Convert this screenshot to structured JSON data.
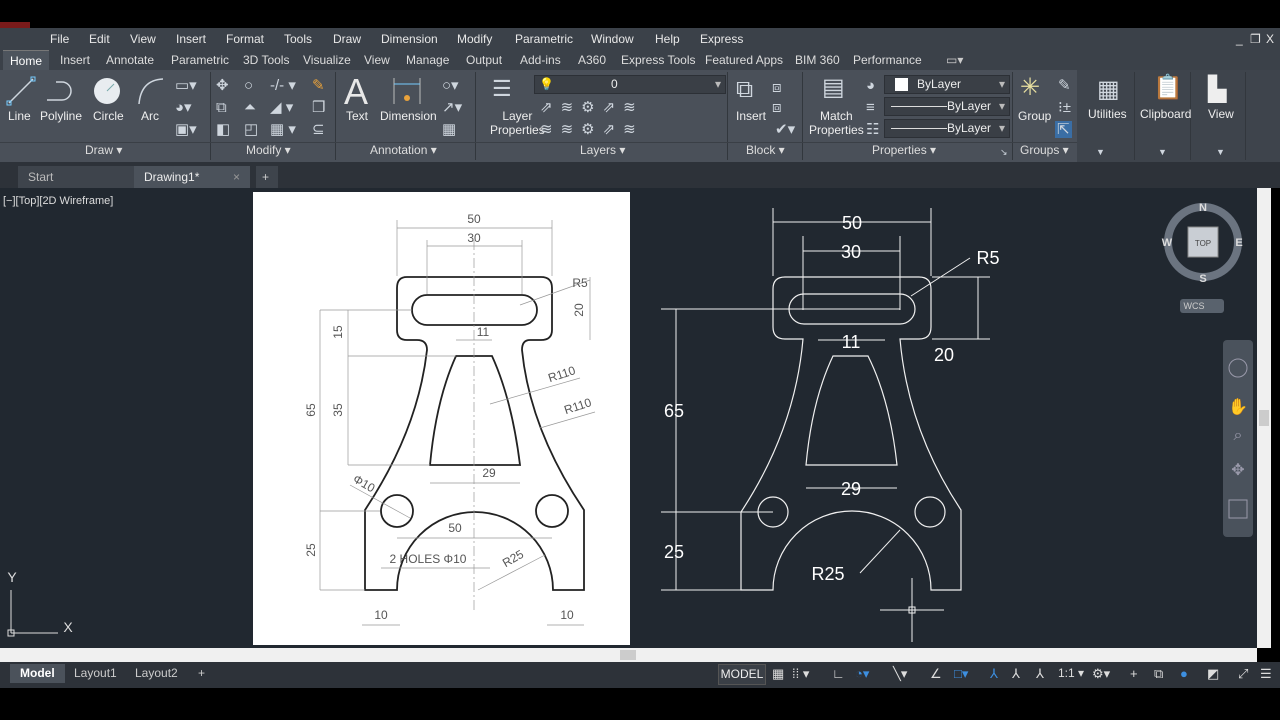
{
  "menu": [
    "File",
    "Edit",
    "View",
    "Insert",
    "Format",
    "Tools",
    "Draw",
    "Dimension",
    "Modify",
    "Parametric",
    "Window",
    "Help",
    "Express"
  ],
  "window_controls": {
    "minimize": "_",
    "restore": "❐",
    "close": "X"
  },
  "ribbon_tabs": [
    "Home",
    "Insert",
    "Annotate",
    "Parametric",
    "3D Tools",
    "Visualize",
    "View",
    "Manage",
    "Output",
    "Add-ins",
    "A360",
    "Express Tools",
    "Featured Apps",
    "BIM 360",
    "Performance"
  ],
  "ribbon": {
    "draw": {
      "title": "Draw ▾",
      "line": "Line",
      "polyline": "Polyline",
      "circle": "Circle",
      "arc": "Arc"
    },
    "modify": {
      "title": "Modify ▾"
    },
    "annotation": {
      "title": "Annotation ▾",
      "text": "Text",
      "dimension": "Dimension"
    },
    "layers": {
      "title": "Layers ▾",
      "layer_properties_1": "Layer",
      "layer_properties_2": "Properties",
      "current_layer": "0"
    },
    "block": {
      "title": "Block ▾",
      "insert": "Insert"
    },
    "properties": {
      "title": "Properties ▾",
      "match_1": "Match",
      "match_2": "Properties",
      "color": "ByLayer",
      "linetype": "ByLayer",
      "lineweight": "ByLayer"
    },
    "groups": {
      "title": "Groups ▾",
      "group": "Group"
    },
    "utilities": "Utilities",
    "clipboard": "Clipboard",
    "view": "View"
  },
  "file_tabs": {
    "start": "Start",
    "drawing": "Drawing1*",
    "close": "×",
    "add": "+"
  },
  "viewport_label": "[−][Top][2D Wireframe]",
  "viewcube": {
    "n": "N",
    "s": "S",
    "e": "E",
    "w": "W",
    "top": "TOP",
    "wcs": "WCS"
  },
  "ucs": {
    "x": "X",
    "y": "Y"
  },
  "reference_drawing": {
    "d50": "50",
    "d30": "30",
    "r5": "R5",
    "d20": "20",
    "d15": "15",
    "d11": "11",
    "r110a": "R110",
    "r110b": "R110",
    "d65": "65",
    "d35": "35",
    "d29": "29",
    "phi10": "Φ10",
    "d50b": "50",
    "holes": "2 HOLES Φ10",
    "r25": "R25",
    "d25": "25",
    "d10a": "10",
    "d10b": "10"
  },
  "cad_drawing": {
    "d50": "50",
    "d30": "30",
    "r5": "R5",
    "d20": "20",
    "d11": "11",
    "d65": "65",
    "d29": "29",
    "d25": "25",
    "r25": "R25"
  },
  "layout_tabs": [
    "Model",
    "Layout1",
    "Layout2"
  ],
  "layout_add": "+",
  "status": {
    "model": "MODEL",
    "scale": "1:1 ▾"
  }
}
